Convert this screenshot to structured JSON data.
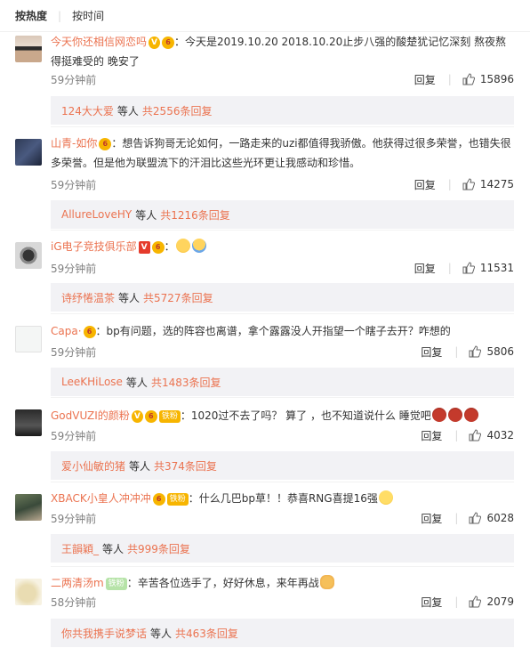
{
  "sort": {
    "hot": "按热度",
    "time": "按时间"
  },
  "comments": [
    {
      "name": "今天你还相信网恋吗",
      "badges": [
        "V",
        "vip"
      ],
      "text": "：今天是2019.10.20  2018.10.20止步八强的酸楚犹记忆深刻 熬夜熬得挺难受的 晚安了",
      "time": "59分钟前",
      "reply": "回复",
      "likes": "15896",
      "sub_who": "124大大爱",
      "sub_mid": "等人",
      "sub_cnt": "共2556条回复"
    },
    {
      "name": "山青-如你",
      "badges": [
        "vip"
      ],
      "text": "：想告诉狗哥无论如何，一路走来的uzi都值得我骄傲。他获得过很多荣誉，也错失很多荣誉。但是他为联盟流下的汗泪比这些光环更让我感动和珍惜。",
      "time": "59分钟前",
      "reply": "回复",
      "likes": "14275",
      "sub_who": "AllureLoveHY",
      "sub_mid": "等人",
      "sub_cnt": "共1216条回复"
    },
    {
      "name": "iG电子竞技俱乐部",
      "badges": [
        "V-red",
        "vip"
      ],
      "text": "：",
      "time": "59分钟前",
      "reply": "回复",
      "likes": "11531",
      "sub_who": "诗纾惓温茶",
      "sub_mid": "等人",
      "sub_cnt": "共5727条回复"
    },
    {
      "name": "Capa·",
      "badges": [
        "vip"
      ],
      "text": "：bp有问题，选的阵容也离谱，拿个露露没人开指望一个瞎子去开？咋想的",
      "time": "59分钟前",
      "reply": "回复",
      "likes": "5806",
      "sub_who": "LeeKHiLose",
      "sub_mid": "等人",
      "sub_cnt": "共1483条回复"
    },
    {
      "name": "GodVUZI的颜粉",
      "badges": [
        "V",
        "vip",
        "fan"
      ],
      "text": "：1020过不去了吗？ 算了 ，也不知道说什么 睡觉吧",
      "time": "59分钟前",
      "reply": "回复",
      "likes": "4032",
      "sub_who": "爱小仙敏的猪",
      "sub_mid": "等人",
      "sub_cnt": "共374条回复"
    },
    {
      "name": "XBACK小皇人冲冲冲",
      "badges": [
        "vip",
        "fan"
      ],
      "text": "：什么几巴bp草！！恭喜RNG喜提16强",
      "time": "59分钟前",
      "reply": "回复",
      "likes": "6028",
      "sub_who": "王韻穎_",
      "sub_mid": "等人",
      "sub_cnt": "共999条回复"
    },
    {
      "name": "二两清汤m",
      "badges": [
        "fan2"
      ],
      "text": "：辛苦各位选手了，好好休息，来年再战",
      "time": "58分钟前",
      "reply": "回复",
      "likes": "2079",
      "sub_who": "你共我携手说梦话",
      "sub_mid": "等人",
      "sub_cnt": "共463条回复"
    }
  ],
  "badge_text": {
    "V": "V",
    "vip": "6",
    "fan": "铁粉",
    "fan2": "铁粉"
  },
  "colors": {
    "accent": "#eb7350",
    "reply_bg": "#f2f2f5",
    "vip": "#f7b500"
  },
  "icons": {
    "like": "thumbs-up-icon"
  }
}
